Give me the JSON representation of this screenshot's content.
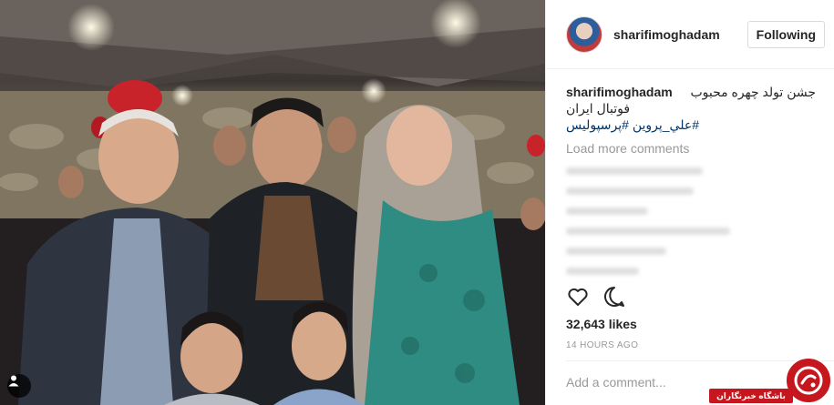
{
  "post": {
    "username": "sharifimoghadam",
    "follow_label": "Following",
    "caption": {
      "user": "sharifimoghadam",
      "text_line1": "جشن تولد چهره محبوب",
      "text_line2": "فوتبال ایران",
      "hashtags": "#علي_پروين #پرسپوليس"
    },
    "load_more_label": "Load more comments",
    "likes": "32,643 likes",
    "time": "14 HOURS AGO",
    "add_comment_placeholder": "Add a comment..."
  },
  "watermark": {
    "text": "باشگاه خبرنگاران"
  },
  "icons": {
    "like": "heart-icon",
    "comment": "comment-bubble-icon",
    "tagged": "user-tag-icon",
    "more": "more-dots-icon"
  },
  "colors": {
    "hashtag": "#003569",
    "muted": "#999999",
    "border": "#efefef",
    "watermark_red": "#c6161e"
  }
}
